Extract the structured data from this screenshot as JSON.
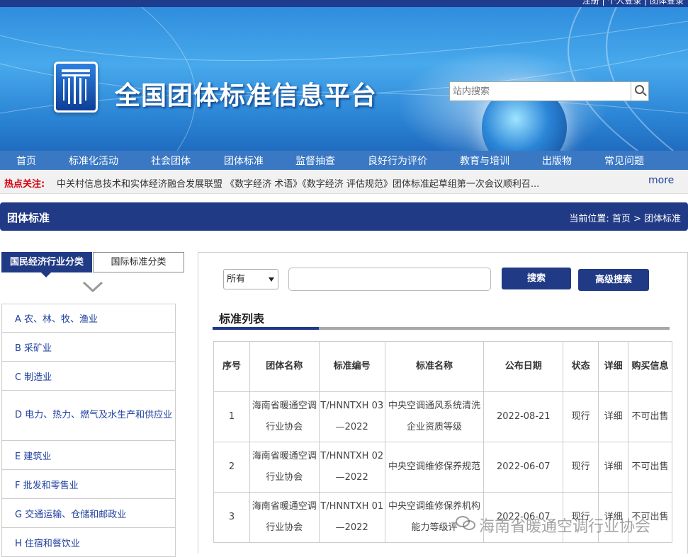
{
  "top_links": "注册 | 个人登录 | 团体登录",
  "site": {
    "title": "全国团体标准信息平台",
    "search_placeholder": "站内搜索",
    "search_icon": "search-icon"
  },
  "nav": [
    "首页",
    "标准化活动",
    "社会团体",
    "团体标准",
    "监督抽查",
    "良好行为评价",
    "教育与培训",
    "出版物",
    "常见问题"
  ],
  "hot": {
    "label": "热点关注:",
    "text": "中关村信息技术和实体经济融合发展联盟 《数字经济 术语》《数字经济 评估规范》团体标准起草组第一次会议顺利召...",
    "more": "more"
  },
  "section": {
    "title": "团体标准",
    "breadcrumb": "当前位置: 首页 > 团体标准"
  },
  "sidebar": {
    "tab_active": "国民经济行业分类",
    "tab_other": "国际标准分类",
    "categories": [
      "A 农、林、牧、渔业",
      "B 采矿业",
      "C 制造业",
      "D 电力、热力、燃气及水生产和供应业",
      "E 建筑业",
      "F 批发和零售业",
      "G 交通运输、仓储和邮政业",
      "H 住宿和餐饮业"
    ]
  },
  "filters": {
    "select_value": "所有",
    "search_button": "搜索",
    "advanced_button": "高级搜索"
  },
  "list": {
    "title": "标准列表",
    "headers": [
      "序号",
      "团体名称",
      "标准编号",
      "标准名称",
      "公布日期",
      "状态",
      "详细",
      "购买信息"
    ],
    "rows": [
      {
        "no": "1",
        "org": "海南省暖通空调行业协会",
        "code": "T/HNNTXH 03—2022",
        "name": "中央空调通风系统清洗企业资质等级",
        "date": "2022-08-21",
        "status": "现行",
        "detail": "详细",
        "buy": "不可出售"
      },
      {
        "no": "2",
        "org": "海南省暖通空调行业协会",
        "code": "T/HNNTXH 02—2022",
        "name": "中央空调维修保养规范",
        "date": "2022-06-07",
        "status": "现行",
        "detail": "详细",
        "buy": "不可出售"
      },
      {
        "no": "3",
        "org": "海南省暖通空调行业协会",
        "code": "T/HNNTXH 01—2022",
        "name": "中央空调维修保养机构能力等级评",
        "date": "2022-06-07",
        "status": "现行",
        "detail": "详细",
        "buy": "不可出售"
      }
    ]
  },
  "watermark": "海南省暖通空调行业协会",
  "colors": {
    "navy": "#213a86",
    "nav_blue": "#3a78c4",
    "hot_red": "#d6000f",
    "link_blue": "#1d3f9e"
  }
}
